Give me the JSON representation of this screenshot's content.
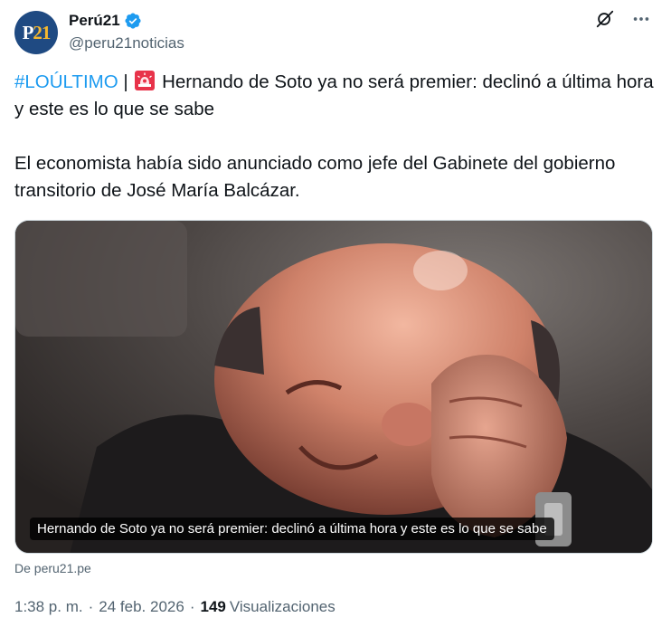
{
  "author": {
    "display_name": "Perú21",
    "handle": "@peru21noticias",
    "avatar_text_p": "P",
    "avatar_text_n": "21",
    "verified": true,
    "brand_color": "#1f4a82"
  },
  "actions": {
    "grok_icon": "grok-icon",
    "more_icon": "more-icon"
  },
  "tweet": {
    "hashtag": "#LOÚLTIMO",
    "separator": " | ",
    "headline": "Hernando de Soto ya no será premier: declinó a última hora y este es lo que se sabe",
    "paragraph": "El economista había sido anunciado como jefe del Gabinete del gobierno transitorio de José María Balcázar.",
    "emoji": "siren-icon"
  },
  "media": {
    "caption": "Hernando de Soto ya no será premier: declinó a última hora y este es lo que se sabe"
  },
  "source": "De peru21.pe",
  "meta": {
    "time": "1:38 p. m.",
    "date": "24 feb. 2026",
    "views_count": "149",
    "views_label": "Visualizaciones"
  },
  "colors": {
    "link": "#1d9bf0",
    "secondary_text": "#536471",
    "primary_text": "#0f1419"
  }
}
